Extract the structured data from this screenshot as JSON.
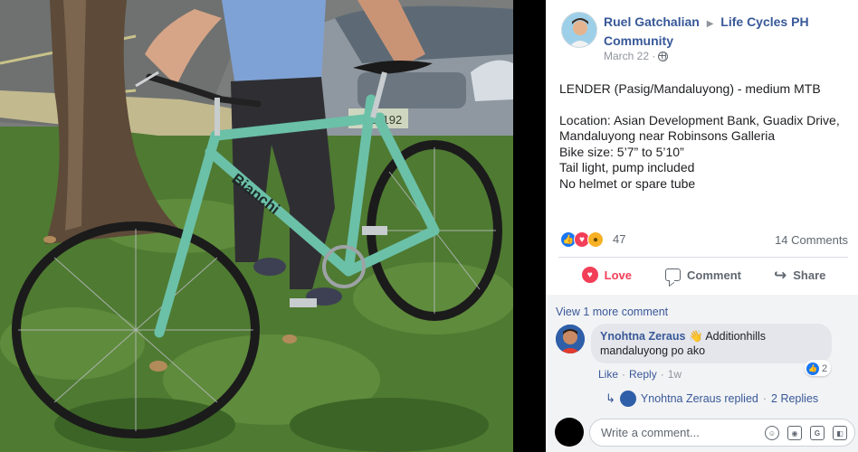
{
  "post": {
    "author": "Ruel Gatchalian",
    "separator_icon": "triangle-right-icon",
    "group_line1": "Life Cycles PH",
    "group_line2": "Community",
    "date": "March 22 ·",
    "privacy_icon": "globe-icon",
    "body": [
      "LENDER (Pasig/Mandaluyong) - medium MTB",
      "",
      "Location: Asian Development Bank, Guadix Drive,",
      "Mandaluyong near Robinsons Galleria",
      "Bike size: 5’7” to 5’10”",
      "Tail light, pump included",
      "No helmet or spare tube"
    ]
  },
  "reactions": {
    "icons": [
      "like-icon",
      "love-icon",
      "wow-icon"
    ],
    "count": "47",
    "comments_count": "14 Comments"
  },
  "actions": {
    "love": "Love",
    "comment": "Comment",
    "share": "Share"
  },
  "comments": {
    "view_more": "View 1 more comment",
    "first": {
      "name": "Ynohtna Zeraus",
      "emoji": "👋",
      "text_line1": "Additionhills",
      "text_line2": "mandaluyong po ako",
      "like_count": "2",
      "like": "Like",
      "reply": "Reply",
      "time": "1w"
    },
    "reply_summary": {
      "text": "Ynohtna Zeraus replied",
      "dot": "·",
      "count": "2 Replies"
    },
    "composer_placeholder": "Write a comment..."
  },
  "colors": {
    "link": "#385898",
    "love": "#f33e58",
    "like": "#1877f2",
    "bike_frame": "#6bc0a8"
  }
}
